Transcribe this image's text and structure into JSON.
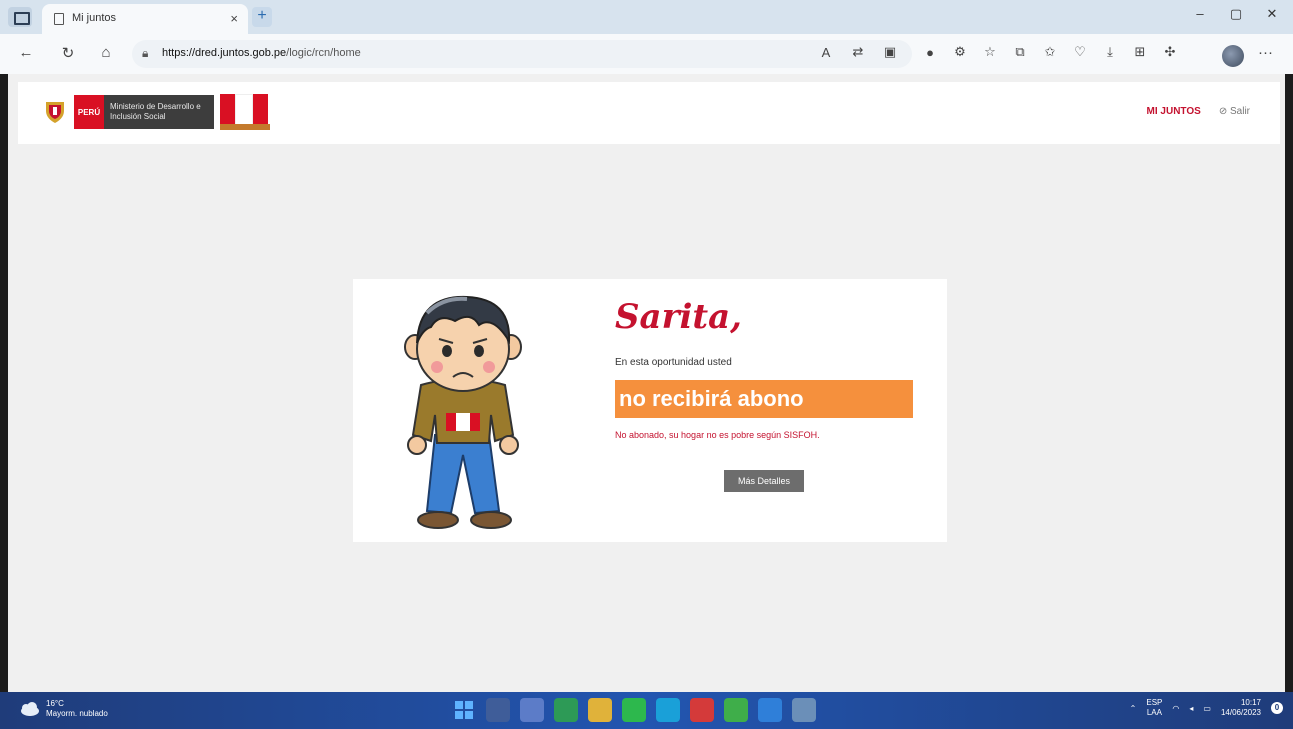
{
  "browser": {
    "tab_title": "Mi juntos",
    "tab_close": "×",
    "new_tab": "+",
    "url_host": "https://dred.juntos.gob.pe",
    "url_path": "/logic/rcn/home",
    "window_controls": [
      "–",
      "▢",
      "✕"
    ]
  },
  "site": {
    "logo_peru": "PERÚ",
    "logo_ministry": "Ministerio de Desarrollo e Inclusión Social",
    "nav_main": "MI JUNTOS",
    "nav_exit": "Salir"
  },
  "card": {
    "greeting": "Sarita,",
    "intro": "En esta oportunidad usted",
    "status": "no recibirá abono",
    "reason": "No abonado, su hogar no es pobre según SISFOH.",
    "more_button": "Más Detalles"
  },
  "taskbar": {
    "weather_temp": "16°C",
    "weather_desc": "Mayorm. nublado",
    "lang_top": "ESP",
    "lang_bottom": "LAA",
    "time": "10:17",
    "date": "14/06/2023",
    "notifications": "0"
  },
  "colors": {
    "brand_red": "#c4122f",
    "banner_orange": "#f5903d",
    "taskbar_blue": "#2255b0"
  }
}
